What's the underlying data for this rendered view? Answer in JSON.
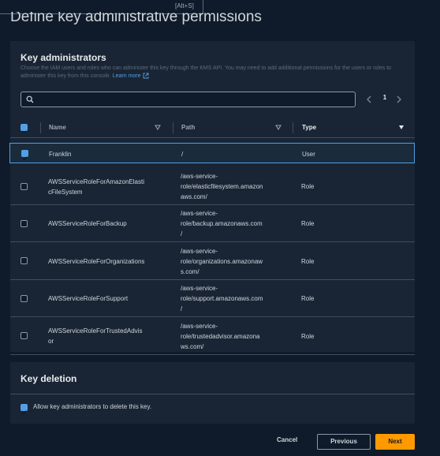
{
  "header": {
    "search_shortcut": "[Alt+S]",
    "page_title": "Define key administrative permissions"
  },
  "key_administrators": {
    "title": "Key administrators",
    "description": "Choose the IAM users and roles who can administer this key through the KMS API. You may need to add additional permissions for the users or roles to administer this key from this console.",
    "learn_more": "Learn more",
    "search": {
      "placeholder": "",
      "value": ""
    },
    "pagination": {
      "current_page": "1"
    },
    "columns": {
      "name": "Name",
      "path": "Path",
      "type": "Type"
    },
    "header_checkbox_state": "indeterminate",
    "rows": [
      {
        "name_lines": [
          "Franklin"
        ],
        "path_lines": [
          "/"
        ],
        "type": "User",
        "checked": true
      },
      {
        "name_lines": [
          "AWSServiceRoleForAmazonElasti",
          "cFileSystem"
        ],
        "path_lines": [
          "/aws-service-",
          "role/elasticfilesystem.amazon",
          "aws.com/"
        ],
        "type": "Role",
        "checked": false
      },
      {
        "name_lines": [
          "AWSServiceRoleForBackup"
        ],
        "path_lines": [
          "/aws-service-",
          "role/backup.amazonaws.com",
          "/"
        ],
        "type": "Role",
        "checked": false
      },
      {
        "name_lines": [
          "AWSServiceRoleForOrganizations"
        ],
        "path_lines": [
          "/aws-service-",
          "role/organizations.amazonaw",
          "s.com/"
        ],
        "type": "Role",
        "checked": false
      },
      {
        "name_lines": [
          "AWSServiceRoleForSupport"
        ],
        "path_lines": [
          "/aws-service-",
          "role/support.amazonaws.com",
          "/"
        ],
        "type": "Role",
        "checked": false
      },
      {
        "name_lines": [
          "AWSServiceRoleForTrustedAdvis",
          "or"
        ],
        "path_lines": [
          "/aws-service-",
          "role/trustedadvisor.amazona",
          "ws.com/"
        ],
        "type": "Role",
        "checked": false
      }
    ]
  },
  "key_deletion": {
    "title": "Key deletion",
    "checkbox_label": "Allow key administrators to delete this key.",
    "checked": true
  },
  "footer": {
    "cancel_label": "Cancel",
    "previous_label": "Previous",
    "next_label": "Next"
  },
  "colors": {
    "background": "#0f1b2a",
    "panel": "#192534",
    "accent": "#539fe5",
    "primary_button": "#ff9900"
  }
}
